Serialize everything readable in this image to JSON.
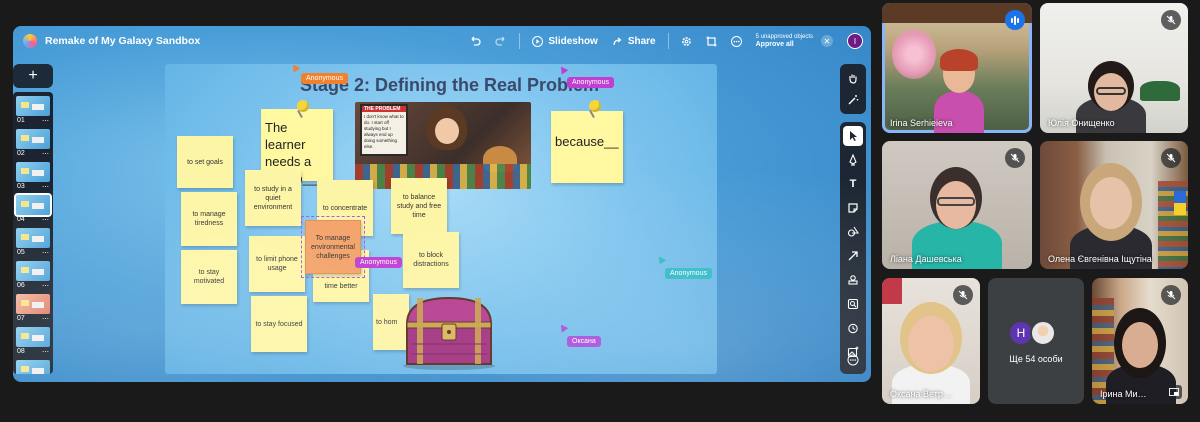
{
  "board": {
    "title": "Remake of My Galaxy Sandbox",
    "toolbar": {
      "slideshow_label": "Slideshow",
      "share_label": "Share",
      "unapproved_text": "5 unapproved objects",
      "approve_all_label": "Approve all",
      "user_initial": "I"
    },
    "add_slide_label": "+",
    "slides": [
      {
        "num": "01"
      },
      {
        "num": "02"
      },
      {
        "num": "03"
      },
      {
        "num": "04"
      },
      {
        "num": "05"
      },
      {
        "num": "06"
      },
      {
        "num": "07"
      },
      {
        "num": "08"
      }
    ],
    "active_slide": "04"
  },
  "slide": {
    "title": "Stage 2: Defining the Real Problem",
    "big_notes": {
      "learner": "The learner needs a way to__",
      "because": "because__"
    },
    "photo_sign": {
      "header": "THE PROBLEM",
      "text": "I don't know what to do. I start off studying but I always end up doing something else."
    },
    "notes": {
      "set_goals": "to set goals",
      "manage_tiredness": "to manage tiredness",
      "stay_motivated": "to stay motivated",
      "study_quiet": "to study in a quiet environment",
      "limit_phone": "to limit phone usage",
      "stay_focused": "to stay focused",
      "concentrate": "to concentrate",
      "time_better": "time better",
      "balance": "to balance study and free time",
      "block_distractions": "to block distractions",
      "hom": "to hom",
      "env_challenges": "To manage environmental challenges"
    },
    "cursors": {
      "anon_top": "Anonymous",
      "anon_title": "Anonymous",
      "anon_selection": "Anonymous",
      "anon_right": "Anonymous",
      "oksana": "Оксана"
    }
  },
  "participants": [
    {
      "name": "Irina Serhieieva",
      "speaking": true
    },
    {
      "name": "Юлія Онищенко",
      "muted": true
    },
    {
      "name": "Ліана Дашевська",
      "muted": true
    },
    {
      "name": "Олена Євгенівна Іщутіна",
      "muted": true
    },
    {
      "name": "Оксана Ветр…",
      "muted": true
    },
    {
      "name": "Ірина Ми…",
      "muted": true
    }
  ],
  "more_participants": {
    "avatar_initial": "H",
    "label": "Ще 54 особи"
  },
  "colors": {
    "anonymous_tag": "#f2812e",
    "anonymous_tag_purple": "#c03fd2",
    "anonymous_tag_teal": "#2bb8c4",
    "oksana_tag": "#a448d8",
    "speaking": "#1a73e8"
  }
}
